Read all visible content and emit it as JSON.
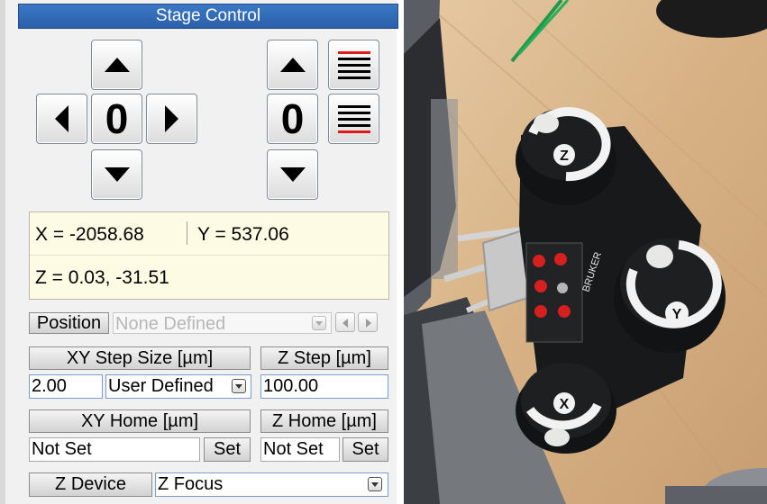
{
  "window": {
    "title": "Stage Control"
  },
  "xy_pad": {
    "counter": "0"
  },
  "z_pad": {
    "counter": "0"
  },
  "readout": {
    "x": "X = -2058.68",
    "y": "Y = 537.06",
    "z": "Z = 0.03, -31.51"
  },
  "position": {
    "label": "Position",
    "value": "None Defined"
  },
  "xy_step": {
    "header": "XY Step Size [µm]",
    "value": "2.00",
    "mode": "User Defined"
  },
  "z_step": {
    "header": "Z Step [µm]",
    "value": "100.00"
  },
  "xy_home": {
    "header": "XY Home [µm]",
    "value": "Not Set",
    "set_label": "Set"
  },
  "z_home": {
    "header": "Z Home [µm]",
    "value": "Not Set",
    "set_label": "Set"
  },
  "z_device": {
    "label": "Z Device",
    "value": "Z Focus"
  },
  "controller": {
    "brand": "BRUKER",
    "z_knob": "Z",
    "y_knob": "Y",
    "x_knob": "X"
  },
  "colors": {
    "title_bar": "#2f67b3",
    "readout_bg": "#fdfbe3",
    "red_line": "#e01818",
    "red_button": "#d61f1f"
  }
}
